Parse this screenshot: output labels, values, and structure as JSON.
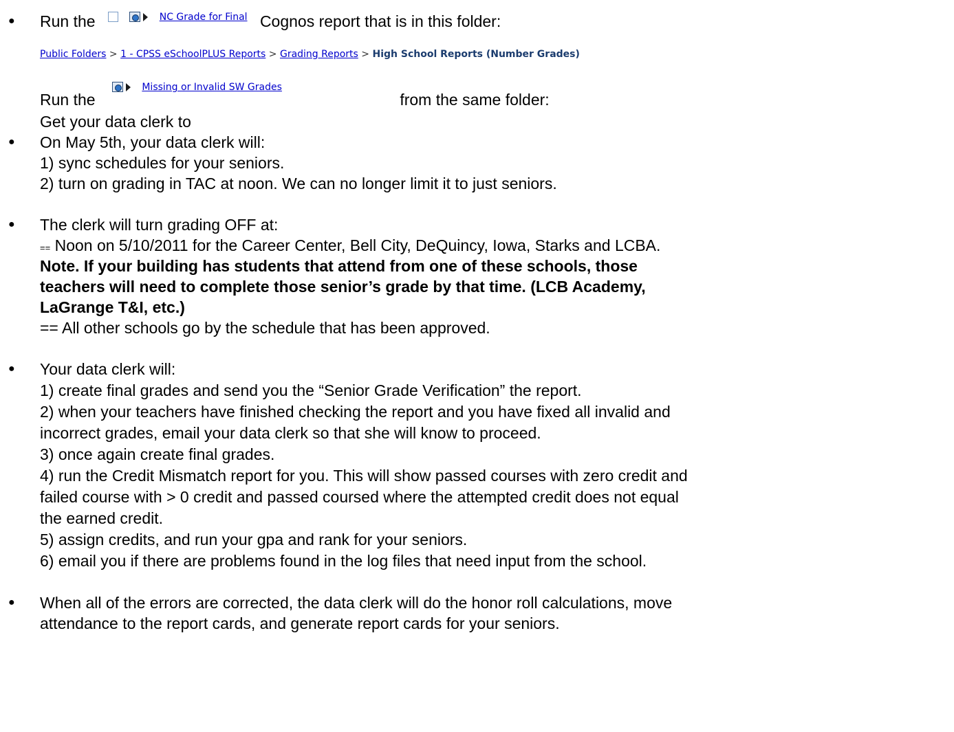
{
  "run_line": {
    "prefix": "Run the",
    "report_name": "NC Grade for Final",
    "suffix": "Cognos report that is in this folder:"
  },
  "breadcrumb": {
    "items": [
      "Public Folders",
      "1 - CPSS eSchoolPLUS Reports",
      "Grading Reports"
    ],
    "separator": ">",
    "current": "High School Reports (Number Grades)"
  },
  "run_line_2": {
    "prefix": "Run the",
    "report_name": "Missing or Invalid SW Grades",
    "suffix": "from the same folder:"
  },
  "clerk_line": "Get your data clerk to",
  "section_may": {
    "intro": "On May 5th, your data clerk will:",
    "items": [
      "1) sync schedules for your seniors.",
      "2) turn on grading in TAC at noon.  We can no longer limit it to just seniors."
    ]
  },
  "section_off": {
    "intro": "The clerk will turn grading OFF at:",
    "eq_marker": "==",
    "noon_line": "Noon on 5/10/2011 for the Career Center, Bell City, DeQuincy, Iowa, Starks and LCBA.",
    "note_lines": [
      "Note.  If your building has students that attend from one of these schools, those",
      "teachers will need to complete those senior’s grade by that time.  (LCB Academy,",
      "LaGrange T&I, etc.)"
    ],
    "other_line": "== All other schools go by the schedule that has been approved."
  },
  "section_clerk": {
    "intro": "Your data clerk will:",
    "lines": [
      "1)  create final grades and send you the “Senior Grade Verification”  the report.",
      "2)  when your teachers have finished checking the report and you have fixed all invalid and",
      "incorrect grades, email your data clerk so that she will know to proceed.",
      "3)  once again create final grades.",
      "4)  run the Credit Mismatch report for you.  This will show passed courses with zero credit and",
      "failed course with > 0 credit and passed coursed where the attempted credit does not equal",
      "the earned credit.",
      "5)  assign credits,  and run your gpa and rank for your seniors.",
      "6)  email you if there are problems found in the log files that need input from the school."
    ]
  },
  "section_final": {
    "lines": [
      "When all of the errors are corrected, the data clerk will do the honor roll calculations, move",
      "attendance to the report cards, and generate report cards for your seniors."
    ]
  }
}
